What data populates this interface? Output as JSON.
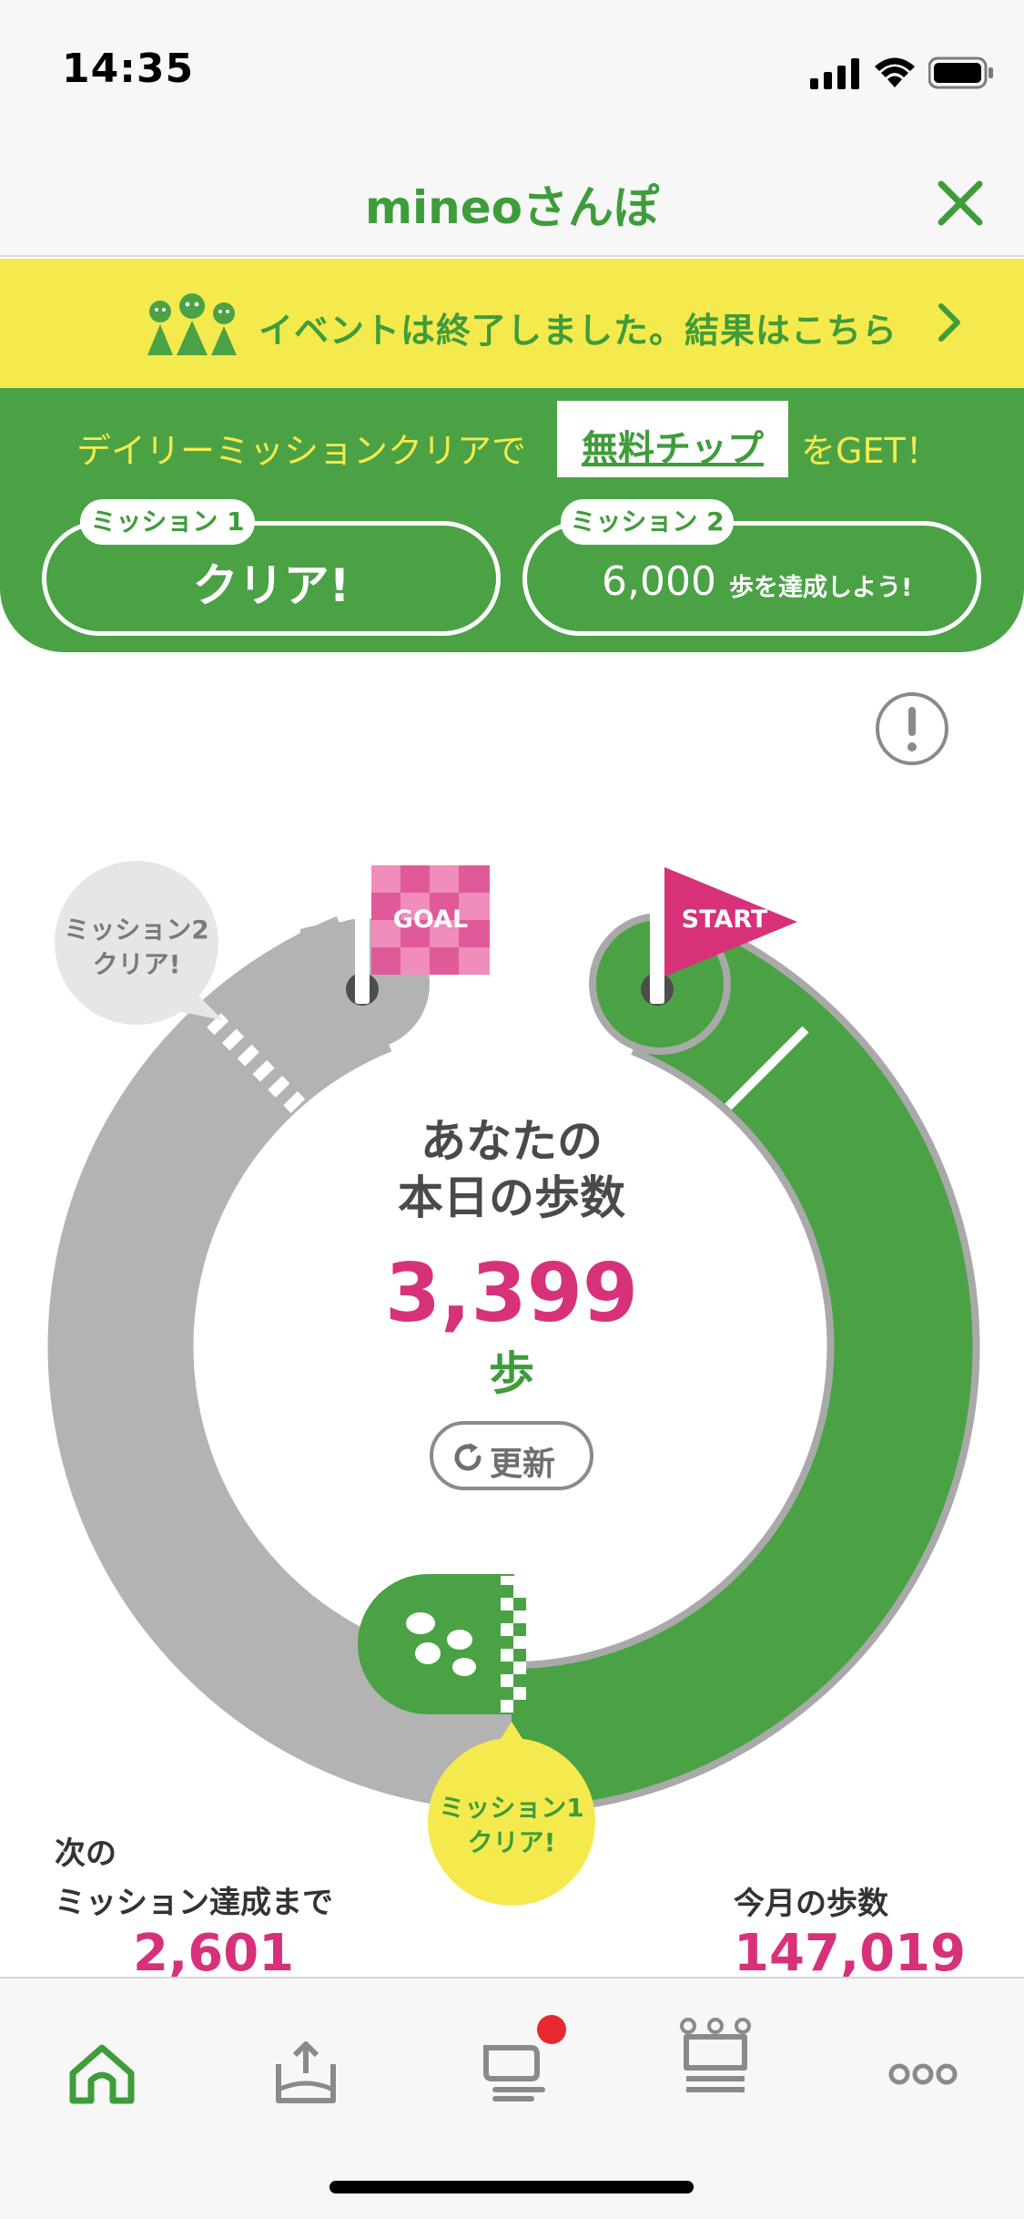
{
  "status_bar": {
    "time": "14:35"
  },
  "header": {
    "title": "mineoさんぽ"
  },
  "banner": {
    "text": "イベントは終了しました。結果はこちら"
  },
  "mission_panel": {
    "prefix": "デイリーミッションクリアで",
    "chip": "無料チップ",
    "suffix": "をGET！",
    "mission1": {
      "tab": "ミッション 1",
      "status": "クリア!"
    },
    "mission2": {
      "tab": "ミッション 2",
      "steps": "6,000",
      "text": "歩を達成しよう!"
    }
  },
  "course": {
    "goal_label": "GOAL",
    "start_label": "START",
    "bubble_mission2": [
      "ミッション2",
      "クリア!"
    ],
    "bubble_mission1": [
      "ミッション1",
      "クリア!"
    ],
    "center_line1": "あなたの",
    "center_line2": "本日の歩数",
    "steps_today": "3,399",
    "steps_unit": "歩",
    "refresh_label": "更新"
  },
  "stats": {
    "next_label_line1": "次の",
    "next_label_line2": "ミッション達成まで",
    "next_value": "2,601",
    "month_label": "今月の歩数",
    "month_value": "147,019"
  },
  "colors": {
    "green": "#4aa245",
    "pink": "#d7317a",
    "yellow": "#f5ea4d",
    "gray_track": "#b3b3b3"
  },
  "tab_bar": {
    "icons": [
      "home-icon",
      "upload-box-icon",
      "chat-icon",
      "crown-icon",
      "more-icon"
    ],
    "chat_badge": true
  }
}
